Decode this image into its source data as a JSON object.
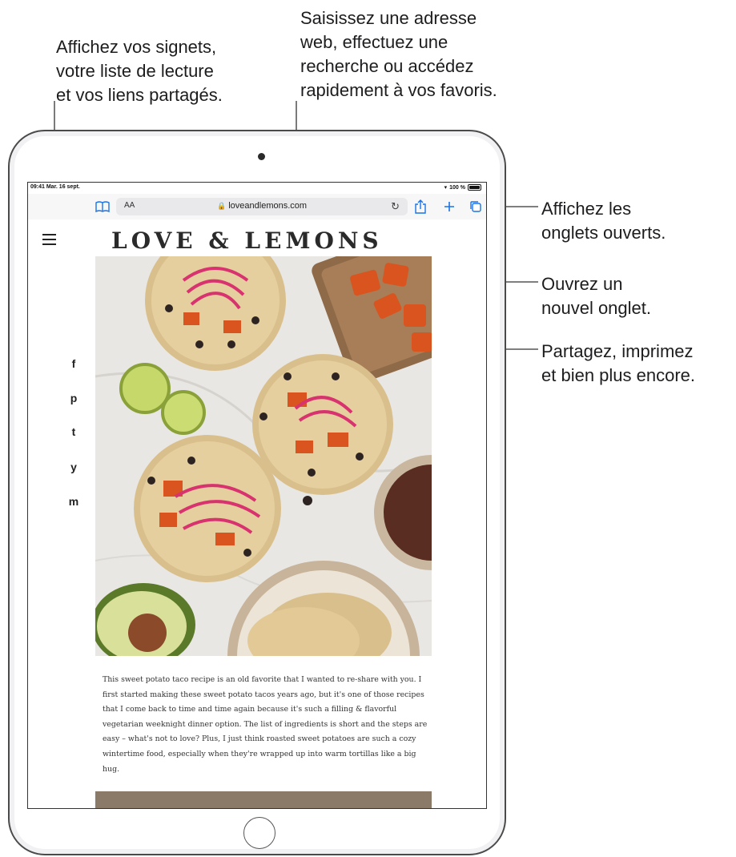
{
  "callouts": {
    "bookmarks": "Affichez vos signets,\nvotre liste de lecture\net vos liens partagés.",
    "address": "Saisissez une adresse\nweb, effectuez une\nrecherche ou accédez\nrapidement à vos favoris.",
    "tabs": "Affichez les\nonglets ouverts.",
    "new_tab": "Ouvrez un\nnouvel onglet.",
    "share": "Partagez, imprimez\net bien plus encore."
  },
  "status_bar": {
    "time_date": "09:41 Mar. 16 sept.",
    "battery": "100 %"
  },
  "toolbar": {
    "text_size": "AA",
    "url": "loveandlemons.com"
  },
  "site": {
    "logo": "LOVE & LEMONS"
  },
  "social_icons": [
    "f",
    "p",
    "t",
    "y",
    "m"
  ],
  "article": {
    "text": "This sweet potato taco recipe is an old favorite that I wanted to re-share with you. I first started making these sweet potato tacos years ago, but it's one of those recipes that I come back to time and time again because it's such a filling & flavorful vegetarian weeknight dinner option. The list of ingredients is short and the steps are easy – what's not to love? Plus, I just think roasted sweet potatoes are such a cozy wintertime food, especially when they're wrapped up into warm tortillas like a big hug."
  },
  "colors": {
    "accent": "#1a73e8",
    "text": "#1d1d1f"
  }
}
